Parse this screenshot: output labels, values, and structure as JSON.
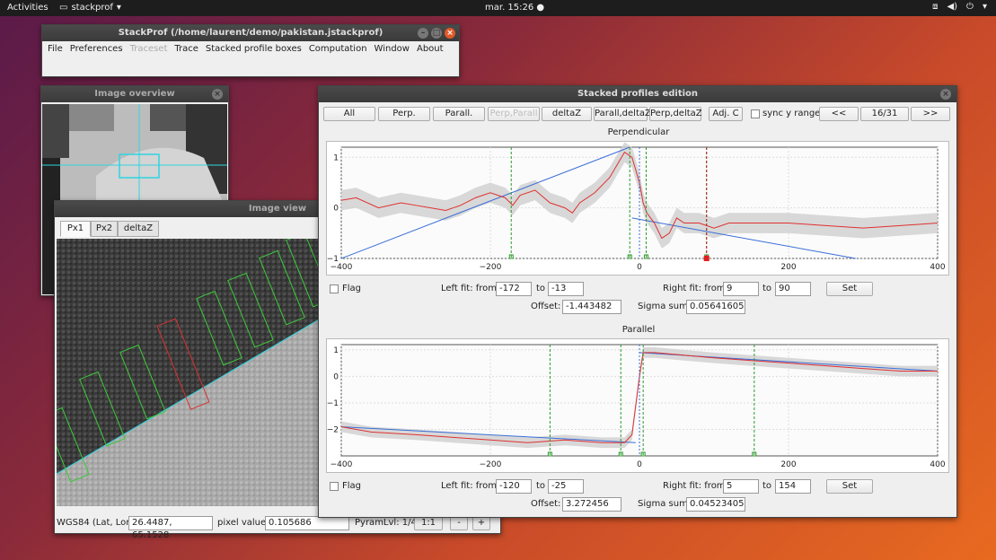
{
  "topbar": {
    "activities": "Activities",
    "app": "stackprof",
    "clock": "mar. 15:26"
  },
  "main_window": {
    "title": "StackProf (/home/laurent/demo/pakistan.jstackprof)",
    "menu": [
      "File",
      "Preferences",
      "Traceset",
      "Trace",
      "Stacked profile boxes",
      "Computation",
      "Window",
      "About"
    ]
  },
  "overview": {
    "title": "Image overview"
  },
  "image_view": {
    "title": "Image view",
    "tabs": [
      "Px1",
      "Px2",
      "deltaZ"
    ],
    "coord_label": "WGS84 (Lat, Lon):",
    "coord_value": "26.4487, 65.1528",
    "pixel_label": "pixel value:",
    "pixel_value": "0.105686",
    "pyram": "PyramLvl: 1/4",
    "btn_11": "1:1",
    "btn_minus": "-",
    "btn_plus": "+"
  },
  "edition": {
    "title": "Stacked profiles edition",
    "buttons": [
      "All",
      "Perp.",
      "Parall.",
      "Perp,Parall",
      "deltaZ",
      "Parall,deltaZ",
      "Perp,deltaZ",
      "Adj. C"
    ],
    "sync": "sync y range",
    "prev": "<<",
    "page": "16/31",
    "next": ">>",
    "perp": {
      "title": "Perpendicular",
      "flag": "Flag",
      "left_label": "Left fit: from",
      "left_from": "-172",
      "to": "to",
      "left_to": "-13",
      "right_label": "Right fit: from",
      "right_from": "9",
      "right_to": "90",
      "set": "Set",
      "offset_label": "Offset:",
      "offset": "-1.443482",
      "sigma_label": "Sigma sum:",
      "sigma": "0.05641605"
    },
    "para": {
      "title": "Parallel",
      "flag": "Flag",
      "left_label": "Left fit: from",
      "left_from": "-120",
      "to": "to",
      "left_to": "-25",
      "right_label": "Right fit: from",
      "right_from": "5",
      "right_to": "154",
      "set": "Set",
      "offset_label": "Offset:",
      "offset": "3.272456",
      "sigma_label": "Sigma sum:",
      "sigma": "0.04523405"
    }
  },
  "chart_data": [
    {
      "type": "line",
      "title": "Perpendicular",
      "xlim": [
        -400,
        400
      ],
      "ylim": [
        -1,
        1.2
      ],
      "x_ticks": [
        "−400",
        "−200",
        "0",
        "200",
        "400"
      ],
      "y_ticks": [
        "1",
        "0",
        "−1"
      ],
      "series": [
        {
          "values": [
            [
              -400,
              0.15
            ],
            [
              -380,
              0.2
            ],
            [
              -350,
              0.0
            ],
            [
              -320,
              0.1
            ],
            [
              -300,
              0.05
            ],
            [
              -280,
              0.0
            ],
            [
              -260,
              -0.05
            ],
            [
              -240,
              0.05
            ],
            [
              -220,
              0.2
            ],
            [
              -200,
              0.3
            ],
            [
              -180,
              0.2
            ],
            [
              -170,
              0.05
            ],
            [
              -160,
              0.25
            ],
            [
              -140,
              0.35
            ],
            [
              -120,
              0.1
            ],
            [
              -100,
              0.0
            ],
            [
              -90,
              -0.1
            ],
            [
              -80,
              0.1
            ],
            [
              -60,
              0.3
            ],
            [
              -40,
              0.6
            ],
            [
              -20,
              1.1
            ],
            [
              -10,
              1.0
            ],
            [
              0,
              0.5
            ],
            [
              5,
              0.1
            ],
            [
              10,
              -0.1
            ],
            [
              20,
              -0.3
            ],
            [
              30,
              -0.6
            ],
            [
              40,
              -0.5
            ],
            [
              50,
              -0.2
            ],
            [
              60,
              -0.3
            ],
            [
              80,
              -0.3
            ],
            [
              100,
              -0.4
            ],
            [
              120,
              -0.3
            ],
            [
              150,
              -0.3
            ],
            [
              200,
              -0.3
            ],
            [
              250,
              -0.35
            ],
            [
              300,
              -0.4
            ],
            [
              350,
              -0.35
            ],
            [
              400,
              -0.3
            ]
          ]
        },
        {
          "values": [
            [
              -400,
              -1.0
            ],
            [
              -13,
              1.2
            ]
          ]
        },
        {
          "values": [
            [
              -10,
              -0.2
            ],
            [
              290,
              -1.0
            ]
          ]
        }
      ],
      "left_fit": [
        -172,
        -13
      ],
      "right_fit": [
        9,
        90
      ]
    },
    {
      "type": "line",
      "title": "Parallel",
      "xlim": [
        -400,
        400
      ],
      "ylim": [
        -3,
        1.2
      ],
      "x_ticks": [
        "−400",
        "−200",
        "0",
        "200",
        "400"
      ],
      "y_ticks": [
        "1",
        "0",
        "−1",
        "−2"
      ],
      "series": [
        {
          "values": [
            [
              -400,
              -1.9
            ],
            [
              -360,
              -2.1
            ],
            [
              -300,
              -2.2
            ],
            [
              -250,
              -2.3
            ],
            [
              -200,
              -2.4
            ],
            [
              -150,
              -2.5
            ],
            [
              -100,
              -2.4
            ],
            [
              -50,
              -2.5
            ],
            [
              -20,
              -2.5
            ],
            [
              -10,
              -2.2
            ],
            [
              0,
              0.0
            ],
            [
              5,
              0.9
            ],
            [
              20,
              0.9
            ],
            [
              60,
              0.8
            ],
            [
              100,
              0.7
            ],
            [
              150,
              0.6
            ],
            [
              200,
              0.5
            ],
            [
              250,
              0.4
            ],
            [
              300,
              0.3
            ],
            [
              350,
              0.2
            ],
            [
              400,
              0.2
            ]
          ]
        },
        {
          "values": [
            [
              -400,
              -1.9
            ],
            [
              -5,
              -2.5
            ]
          ]
        },
        {
          "values": [
            [
              0,
              0.9
            ],
            [
              400,
              0.2
            ]
          ]
        }
      ],
      "left_fit": [
        -120,
        -25
      ],
      "right_fit": [
        5,
        154
      ]
    }
  ]
}
